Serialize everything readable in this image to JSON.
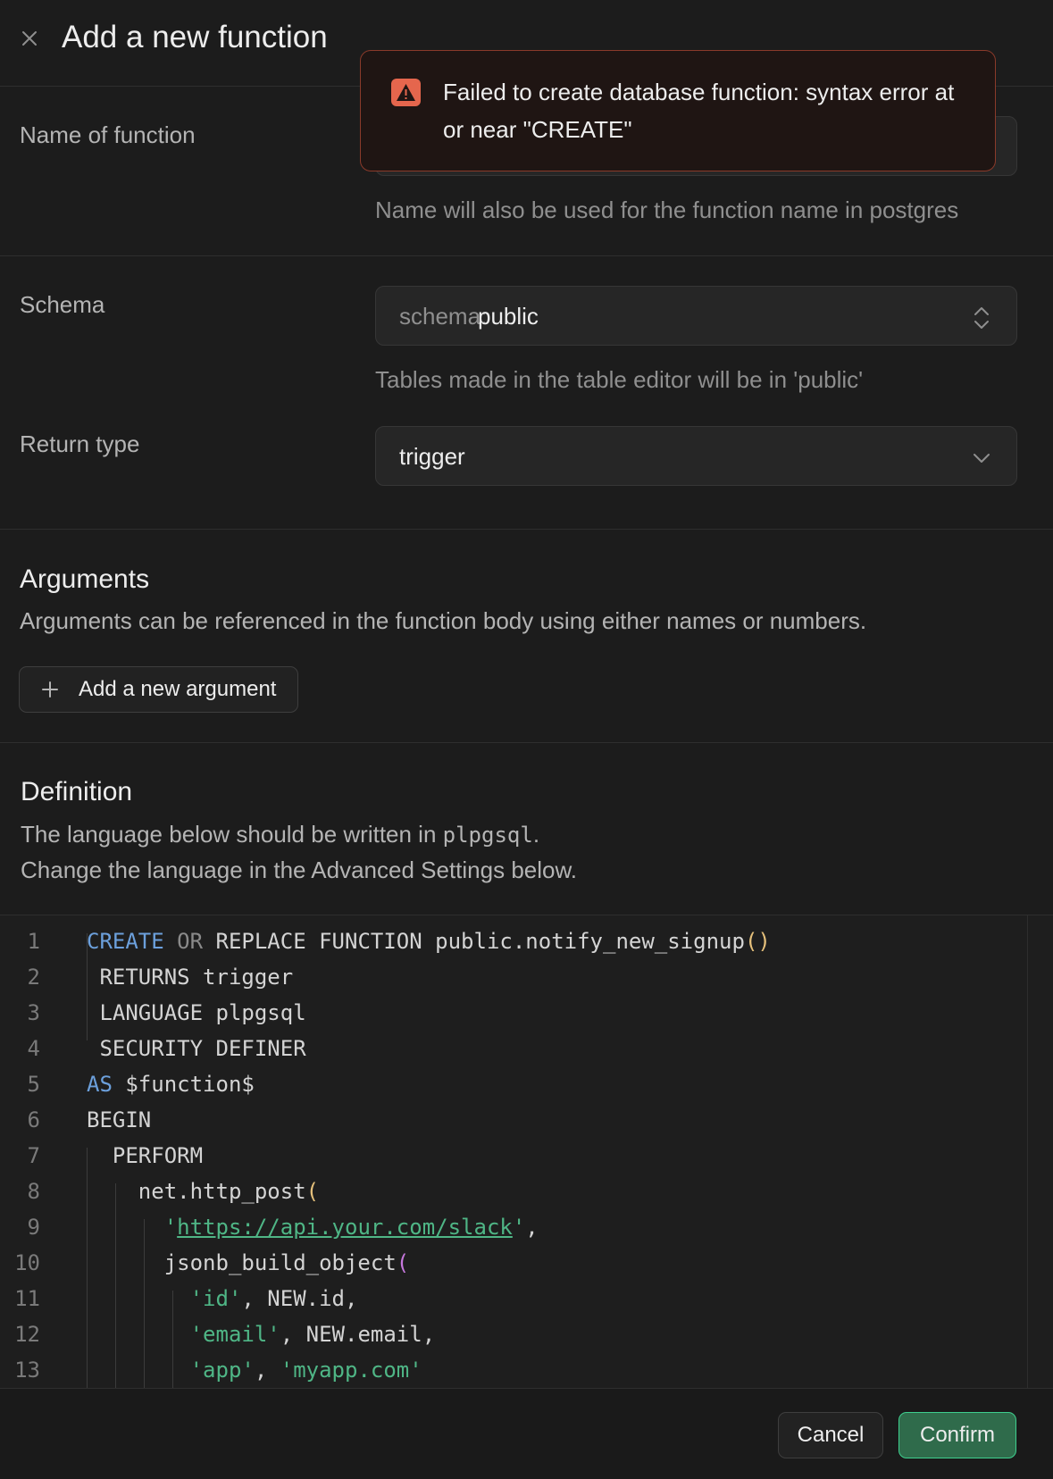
{
  "dialog": {
    "title": "Add a new function"
  },
  "toast": {
    "message": "Failed to create database function: syntax error at or near \"CREATE\""
  },
  "name_field": {
    "label": "Name of function",
    "hint": "Name will also be used for the function name in postgres"
  },
  "schema_field": {
    "label": "Schema",
    "prefix": "schema:",
    "value": "public",
    "hint": "Tables made in the table editor will be in 'public'"
  },
  "return_type": {
    "label": "Return type",
    "value": "trigger"
  },
  "arguments": {
    "heading": "Arguments",
    "description": "Arguments can be referenced in the function body using either names or numbers.",
    "add_button": "Add a new argument"
  },
  "definition": {
    "heading": "Definition",
    "line1_before": "The language below should be written in ",
    "language": "plpgsql",
    "line1_after": ".",
    "line2": "Change the language in the Advanced Settings below."
  },
  "code_lines": [
    "CREATE OR REPLACE FUNCTION public.notify_new_signup()",
    " RETURNS trigger",
    " LANGUAGE plpgsql",
    " SECURITY DEFINER",
    "AS $function$",
    "BEGIN",
    "  PERFORM",
    "    net.http_post(",
    "      'https://api.your.com/slack',",
    "      jsonb_build_object(",
    "        'id', NEW.id,",
    "        'email', NEW.email,",
    "        'app', 'myapp.com'"
  ],
  "line_numbers": [
    "1",
    "2",
    "3",
    "4",
    "5",
    "6",
    "7",
    "8",
    "9",
    "10",
    "11",
    "12",
    "13"
  ],
  "footer": {
    "cancel": "Cancel",
    "confirm": "Confirm"
  },
  "colors": {
    "accent": "#3ecf8e",
    "error": "#e5664d",
    "background": "#1c1c1c"
  },
  "icons": {
    "close": "close-icon",
    "warning": "warning-icon",
    "schema_chevron": "chevron-up-down-icon",
    "return_chevron": "chevron-down-icon",
    "add": "plus-icon"
  }
}
